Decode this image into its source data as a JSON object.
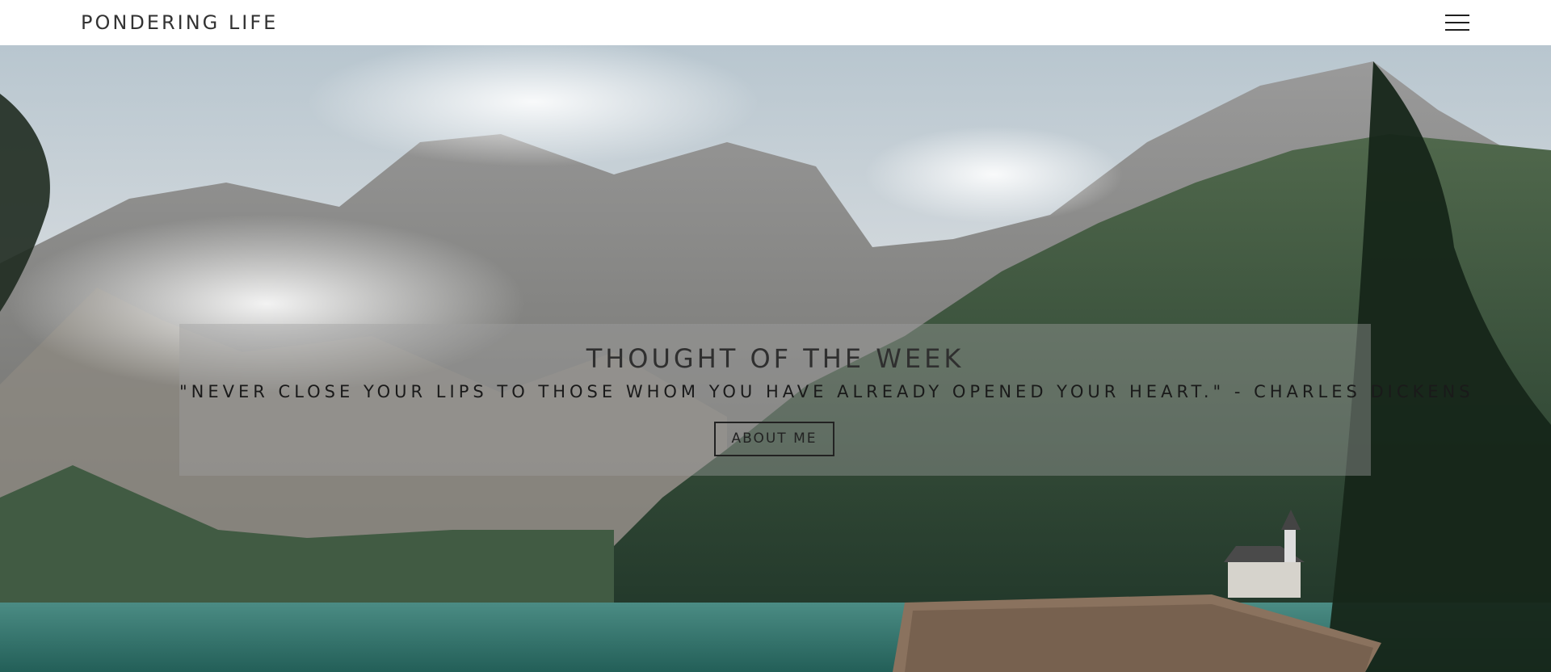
{
  "site": {
    "brand": "PONDERING LIFE"
  },
  "header": {
    "menu_icon": "hamburger-menu-icon"
  },
  "hero": {
    "image_subject": "mountain-lake-landscape",
    "quote_panel": {
      "heading": "THOUGHT OF THE WEEK",
      "quote": "\"NEVER CLOSE YOUR LIPS TO THOSE WHOM YOU HAVE ALREADY OPENED YOUR HEART.\" - CHARLES DICKENS",
      "button_label": "ABOUT ME"
    }
  },
  "colors": {
    "header_bg": "#ffffff",
    "brand_text": "#333333",
    "panel_overlay": "rgba(160,160,160,0.42)",
    "forest": "#2f4a35",
    "lake": "#2f7a70"
  }
}
